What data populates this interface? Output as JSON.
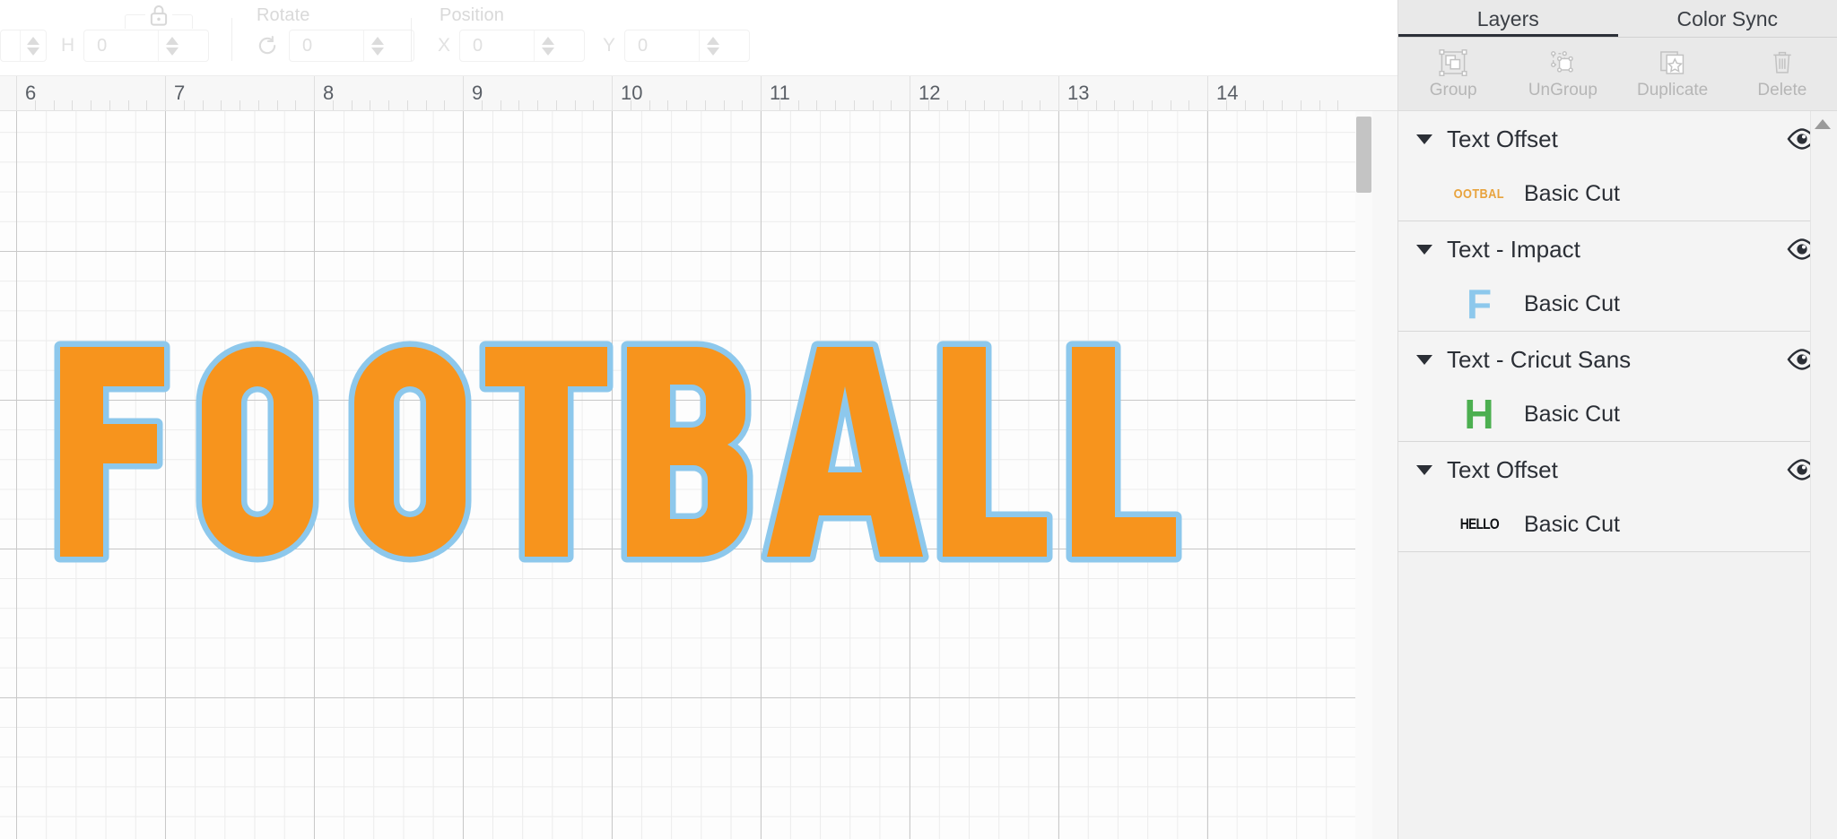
{
  "toolbar": {
    "size": {
      "h_letter": "H",
      "h_value": "0",
      "lock_icon": "lock-icon"
    },
    "rotate": {
      "label": "Rotate",
      "value": "0",
      "icon": "rotate-icon"
    },
    "position": {
      "label": "Position",
      "x_letter": "X",
      "x_value": "0",
      "y_letter": "Y",
      "y_value": "0"
    }
  },
  "ruler": {
    "unit_marks": [
      "6",
      "7",
      "8",
      "9",
      "10",
      "11",
      "12",
      "13",
      "14"
    ]
  },
  "canvas": {
    "artwork_text": "FOOTBALL",
    "fill_color": "#F7941D",
    "outline_color": "#8DC8EC",
    "grid_major_color": "#c9c9c9",
    "grid_minor_color": "#ececec"
  },
  "panel": {
    "tabs": [
      {
        "label": "Layers",
        "active": true
      },
      {
        "label": "Color Sync",
        "active": false
      }
    ],
    "actions": [
      {
        "label": "Group",
        "icon": "group-icon"
      },
      {
        "label": "UnGroup",
        "icon": "ungroup-icon"
      },
      {
        "label": "Duplicate",
        "icon": "duplicate-icon"
      },
      {
        "label": "Delete",
        "icon": "trash-icon"
      }
    ],
    "layer_groups": [
      {
        "title": "Text Offset",
        "visibility_icon": "eye-icon",
        "rows": [
          {
            "thumb_kind": "football",
            "thumb_text": "FOOTBALL",
            "thumb_color": "#E8A33D",
            "label": "Basic Cut"
          }
        ]
      },
      {
        "title": "Text - Impact",
        "visibility_icon": "eye-icon",
        "rows": [
          {
            "thumb_kind": "letter",
            "thumb_text": "F",
            "thumb_color": "#8DC8EC",
            "label": "Basic Cut"
          }
        ]
      },
      {
        "title": "Text - Cricut Sans",
        "visibility_icon": "eye-icon",
        "rows": [
          {
            "thumb_kind": "letter",
            "thumb_text": "H",
            "thumb_color": "#4CAF50",
            "label": "Basic Cut"
          }
        ]
      },
      {
        "title": "Text Offset",
        "visibility_icon": "eye-icon",
        "rows": [
          {
            "thumb_kind": "hello",
            "thumb_text": "HELLO",
            "thumb_color": "#111316",
            "label": "Basic Cut"
          }
        ]
      }
    ]
  }
}
